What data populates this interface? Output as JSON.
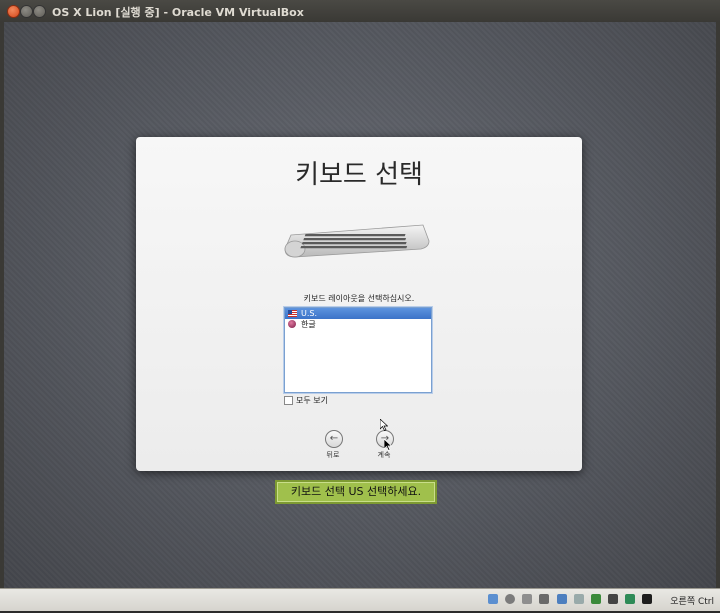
{
  "window": {
    "title": "OS X Lion [실행 중] - Oracle VM VirtualBox"
  },
  "installer": {
    "title": "키보드 선택",
    "instruction": "키보드 레이아웃을 선택하십시오.",
    "layouts": [
      {
        "label": "U.S.",
        "selected": true,
        "flag": "us-flag-icon"
      },
      {
        "label": "한글",
        "selected": false,
        "flag": "korea-flag-icon"
      }
    ],
    "show_all_label": "모두 보기",
    "back_label": "뒤로",
    "next_label": "계속"
  },
  "annotation": {
    "text": "키보드 선택 US 선택하세요."
  },
  "statusbar": {
    "host_key": "오른쪽 Ctrl"
  },
  "colors": {
    "selection": "#3b73c8",
    "annotation_bg": "#a0c04c",
    "close_button": "#d6471a"
  }
}
